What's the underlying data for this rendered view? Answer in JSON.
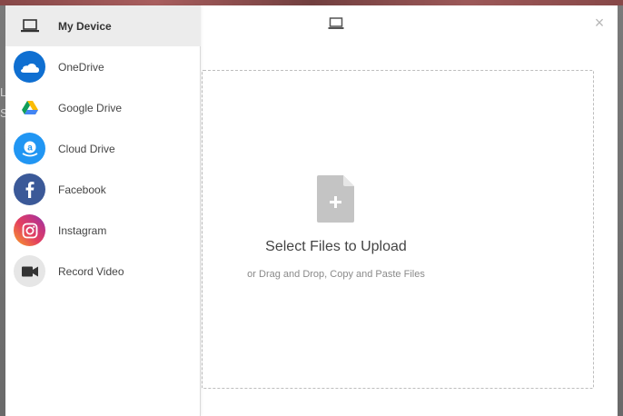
{
  "header": {
    "device_icon": "laptop-icon",
    "close_icon": "close-icon",
    "close_label": "×"
  },
  "sidebar": {
    "items": [
      {
        "label": "My Device",
        "icon": "laptop-icon",
        "active": true
      },
      {
        "label": "OneDrive",
        "icon": "onedrive-icon",
        "color": "#0f6fd1"
      },
      {
        "label": "Google Drive",
        "icon": "google-drive-icon"
      },
      {
        "label": "Cloud Drive",
        "icon": "amazon-cloud-drive-icon",
        "color": "#2196f3"
      },
      {
        "label": "Facebook",
        "icon": "facebook-icon",
        "color": "#3b5998"
      },
      {
        "label": "Instagram",
        "icon": "instagram-icon"
      },
      {
        "label": "Record Video",
        "icon": "video-camera-icon",
        "color": "#e6e6e6"
      }
    ]
  },
  "main": {
    "title": "Select Files to Upload",
    "subtitle": "or Drag and Drop, Copy and Paste Files",
    "file_icon": "add-file-icon"
  },
  "backdrop": {
    "fragments": [
      "L",
      "S"
    ]
  }
}
